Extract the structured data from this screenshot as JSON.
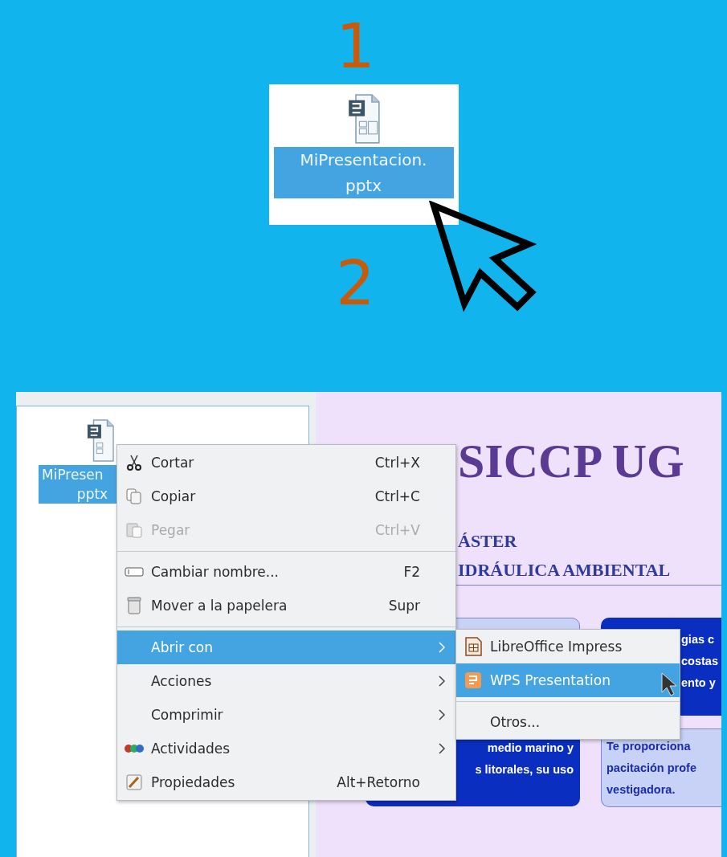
{
  "step_1": {
    "number": "1",
    "file": {
      "label_lines": [
        "MiPresentacion.",
        "pptx"
      ],
      "selected": true
    }
  },
  "step_2": {
    "number": "2"
  },
  "screenshot": {
    "file": {
      "label_lines": [
        "MiPresen",
        "pptx"
      ],
      "selected": true
    },
    "context_menu": [
      {
        "kind": "item",
        "label": "Cortar",
        "shortcut": "Ctrl+X",
        "disabled": false,
        "selected": false,
        "submenu": false
      },
      {
        "kind": "item",
        "label": "Copiar",
        "shortcut": "Ctrl+C",
        "disabled": false,
        "selected": false,
        "submenu": false
      },
      {
        "kind": "item",
        "label": "Pegar",
        "shortcut": "Ctrl+V",
        "disabled": true,
        "selected": false,
        "submenu": false
      },
      {
        "kind": "separator"
      },
      {
        "kind": "item",
        "label": "Cambiar nombre...",
        "shortcut": "F2",
        "disabled": false,
        "selected": false,
        "submenu": false
      },
      {
        "kind": "item",
        "label": "Mover a la papelera",
        "shortcut": "Supr",
        "disabled": false,
        "selected": false,
        "submenu": false
      },
      {
        "kind": "separator"
      },
      {
        "kind": "item",
        "label": "Abrir con",
        "disabled": false,
        "selected": true,
        "submenu": true
      },
      {
        "kind": "item",
        "label": "Acciones",
        "disabled": false,
        "selected": false,
        "submenu": true
      },
      {
        "kind": "item",
        "label": "Comprimir",
        "disabled": false,
        "selected": false,
        "submenu": true
      },
      {
        "kind": "item",
        "label": "Actividades",
        "disabled": false,
        "selected": false,
        "submenu": true
      },
      {
        "kind": "item",
        "label": "Propiedades",
        "shortcut": "Alt+Retorno",
        "disabled": false,
        "selected": false,
        "submenu": false
      }
    ],
    "submenu": [
      {
        "kind": "app",
        "label": "LibreOffice Impress",
        "selected": false
      },
      {
        "kind": "app",
        "label": "WPS Presentation",
        "selected": true
      },
      {
        "kind": "separator"
      },
      {
        "kind": "item",
        "label": "Otros...",
        "selected": false
      }
    ],
    "slide": {
      "title": "SICCP UG",
      "subtitle_lines": [
        "ÁSTER",
        "IDRÁULICA AMBIENTAL"
      ],
      "left_card_lines": [
        "medio marino y",
        "s litorales, su uso"
      ],
      "right_top_card_lines": [
        "gias c",
        "costas",
        "ento y"
      ],
      "right_bottom_card_lines": [
        "Te proporciona",
        "pacitación profe",
        "vestigadora."
      ]
    }
  }
}
